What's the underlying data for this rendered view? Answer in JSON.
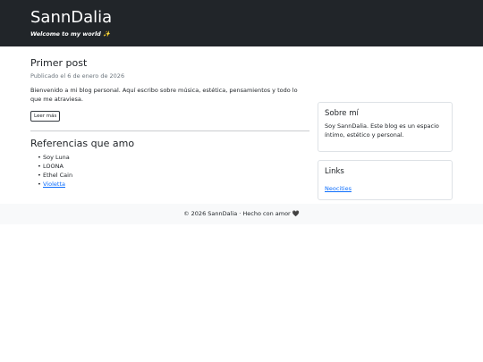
{
  "header": {
    "title": "SannDalia",
    "tagline": "Welcome to my world ✨"
  },
  "post": {
    "title": "Primer post",
    "date": "Publicado el 6 de enero de 2026",
    "body": "Bienvenido a mi blog personal. Aquí escribo sobre música, estética, pensamientos y todo lo que me atraviesa.",
    "read_more": "Leer más"
  },
  "references": {
    "title": "Referencias que amo",
    "items": [
      "Soy Luna",
      "LOONA",
      "Ethel Cain",
      "Violetta"
    ]
  },
  "sidebar": {
    "about": {
      "title": "Sobre mí",
      "text": "Soy SannDalia. Este blog es un espacio íntimo, estético y personal."
    },
    "links": {
      "title": "Links",
      "items": [
        "Neocities"
      ]
    }
  },
  "footer": {
    "text": "© 2026 SannDalia · Hecho con amor 🖤"
  },
  "colors": {
    "header_bg": "#212529",
    "link": "#0d6efd",
    "footer_bg": "#f8f9fa"
  }
}
